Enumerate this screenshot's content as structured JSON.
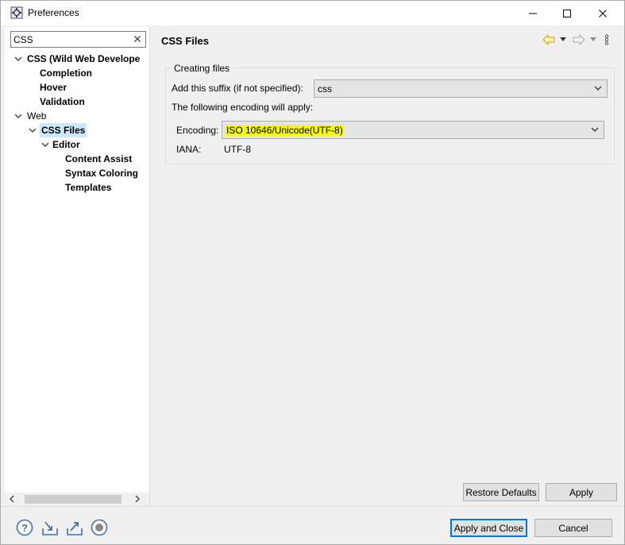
{
  "window": {
    "title": "Preferences"
  },
  "filter": {
    "value": "CSS"
  },
  "tree": {
    "items": [
      {
        "label": "CSS (Wild Web Develope",
        "bold": true
      },
      {
        "label": "Completion",
        "bold": true
      },
      {
        "label": "Hover",
        "bold": true
      },
      {
        "label": "Validation",
        "bold": true
      },
      {
        "label": "Web",
        "bold": false
      },
      {
        "label": "CSS Files",
        "bold": true,
        "selected": true
      },
      {
        "label": "Editor",
        "bold": true
      },
      {
        "label": "Content Assist",
        "bold": true
      },
      {
        "label": "Syntax Coloring",
        "bold": true
      },
      {
        "label": "Templates",
        "bold": true
      }
    ]
  },
  "page": {
    "title": "CSS Files",
    "group_title": "Creating files",
    "suffix_label": "Add this suffix (if not specified):",
    "suffix_value": "css",
    "encoding_intro": "The following encoding will apply:",
    "encoding_label": "Encoding:",
    "encoding_value": "ISO 10646/Unicode(UTF-8)",
    "iana_label": "IANA:",
    "iana_value": "UTF-8",
    "restore_defaults": "Restore Defaults",
    "apply": "Apply"
  },
  "footer": {
    "apply_and_close": "Apply and Close",
    "cancel": "Cancel",
    "icons": [
      "help-icon",
      "import-icon",
      "export-icon",
      "record-icon"
    ]
  },
  "colors": {
    "selection": "#cce8ff",
    "highlight": "#f4f719",
    "default_button_border": "#0078d7"
  }
}
